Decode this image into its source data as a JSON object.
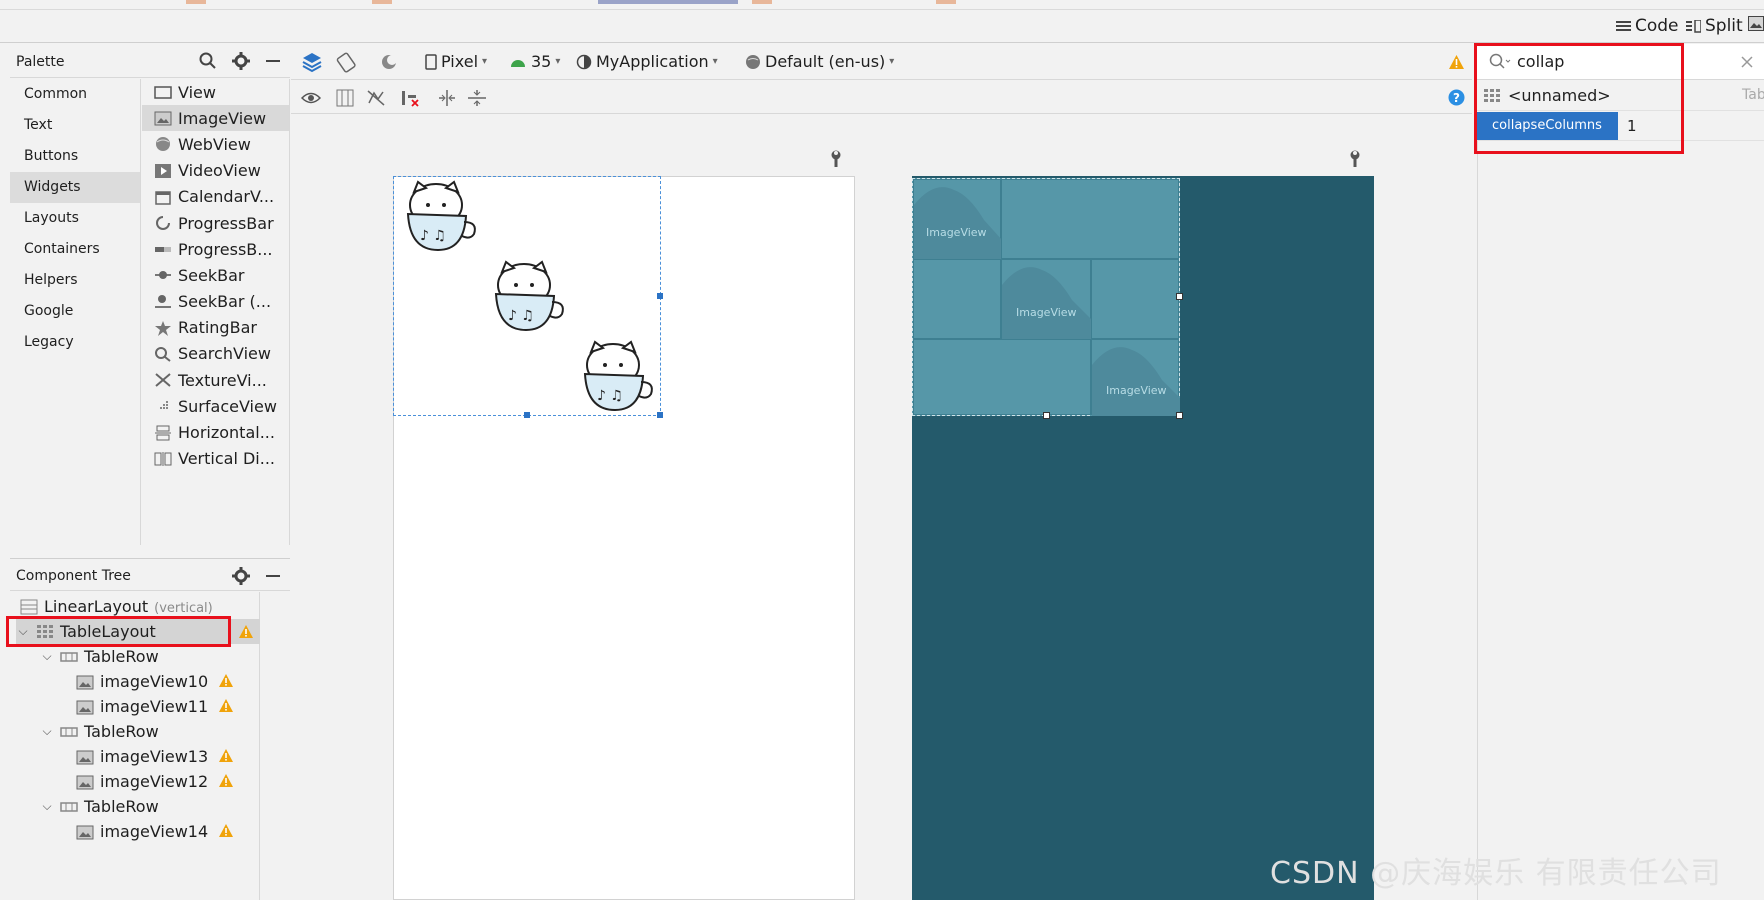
{
  "view_modes": {
    "code": "Code",
    "split": "Split"
  },
  "palette": {
    "title": "Palette",
    "categories": [
      "Common",
      "Text",
      "Buttons",
      "Widgets",
      "Layouts",
      "Containers",
      "Helpers",
      "Google",
      "Legacy"
    ],
    "selected_category": "Widgets",
    "items": [
      "View",
      "ImageView",
      "WebView",
      "VideoView",
      "CalendarV...",
      "ProgressBar",
      "ProgressB...",
      "SeekBar",
      "SeekBar (...",
      "RatingBar",
      "SearchView",
      "TextureVi...",
      "SurfaceView",
      "Horizontal...",
      "Vertical Di..."
    ],
    "selected_item": "ImageView"
  },
  "toolbar": {
    "device": "Pixel",
    "api": "35",
    "theme": "MyApplication",
    "locale": "Default (en-us)"
  },
  "component_tree": {
    "title": "Component Tree",
    "root": {
      "label": "LinearLayout",
      "sub": "(vertical)"
    },
    "table": "TableLayout",
    "row_label": "TableRow",
    "rows": [
      {
        "children": [
          "imageView10",
          "imageView11"
        ]
      },
      {
        "children": [
          "imageView13",
          "imageView12"
        ]
      },
      {
        "children": [
          "imageView14"
        ]
      }
    ]
  },
  "blueprint": {
    "image_label": "ImageView"
  },
  "attributes": {
    "search_value": "collap",
    "component_label": "<unnamed>",
    "partial_tab": "Tab",
    "attr_name": "collapseColumns",
    "attr_value": "1"
  },
  "watermark": "CSDN @庆海娱乐 有限责任公司",
  "colors": {
    "highlight_red": "#e8101c",
    "warning": "#f0a30a",
    "blueprint_bg": "#245a6b",
    "selection_blue": "#2b73c5"
  }
}
